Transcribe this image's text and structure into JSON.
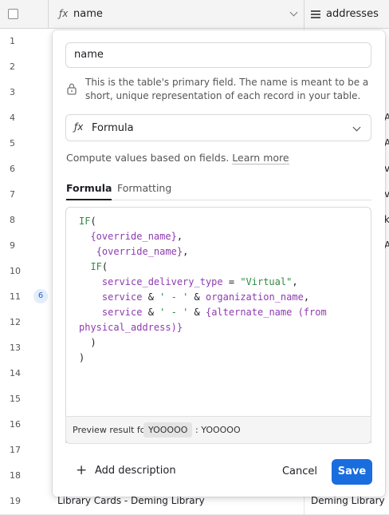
{
  "grid": {
    "columns": {
      "name": "name",
      "addresses": "addresses"
    },
    "row_numbers": [
      "1",
      "2",
      "3",
      "4",
      "5",
      "6",
      "7",
      "8",
      "9",
      "10",
      "11",
      "12",
      "13",
      "14",
      "15",
      "16",
      "17",
      "18",
      "19"
    ],
    "row_11_badge": "6",
    "last_row": {
      "name": "Library Cards - Deming Library",
      "address": "Deming Library"
    },
    "right_edge_fragments": [
      "A",
      "A",
      "v",
      "v",
      "ki",
      "A"
    ]
  },
  "dialog": {
    "field_name_value": "name",
    "primary_note": "This is the table's primary field. The name is meant to be a short, unique representation of each record in your table.",
    "field_type": {
      "icon": "formula-icon",
      "label": "Formula"
    },
    "compute_desc": "Compute values based on fields.",
    "learn_more": "Learn more",
    "tabs": {
      "formula": "Formula",
      "formatting": "Formatting"
    },
    "formula_lines": [
      "IF(",
      "  {override_name},",
      "   {override_name},",
      "  IF(",
      "    service_delivery_type = \"Virtual\",",
      "    service & ' - ' & organization_name,",
      "    service & ' - ' & {alternate_name (from",
      "physical_address)}",
      "  )",
      ")"
    ],
    "preview": {
      "label": "Preview result for",
      "chip": "YOOOOO",
      "value": ": YOOOOO"
    },
    "add_description": "Add description",
    "cancel": "Cancel",
    "save": "Save"
  },
  "colors": {
    "primary": "#1a6dde",
    "keyword": "#2f8a43",
    "field": "#8e3bb0"
  }
}
